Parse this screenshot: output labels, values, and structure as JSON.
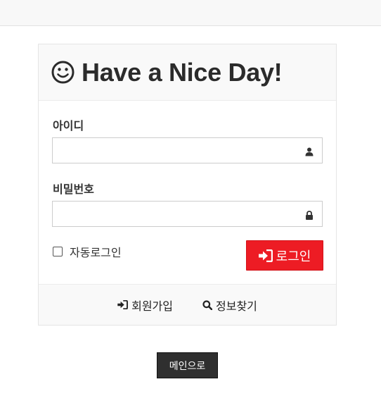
{
  "header": {
    "title": "Have a Nice Day!",
    "title_icon": "smiley-icon"
  },
  "form": {
    "id_label": "아이디",
    "id_value": "",
    "id_icon": "user-icon",
    "password_label": "비밀번호",
    "password_value": "",
    "password_icon": "lock-icon",
    "remember_label": "자동로그인",
    "remember_checked": false,
    "login_button_label": "로그인",
    "login_button_icon": "sign-in-icon"
  },
  "footer": {
    "signup_label": "회원가입",
    "signup_icon": "sign-in-icon",
    "find_info_label": "정보찾기",
    "find_info_icon": "search-icon"
  },
  "main_button_label": "메인으로",
  "colors": {
    "accent": "#ed1c24",
    "dark_button": "#2f2f2f",
    "panel_bg": "#f9f9f9"
  }
}
